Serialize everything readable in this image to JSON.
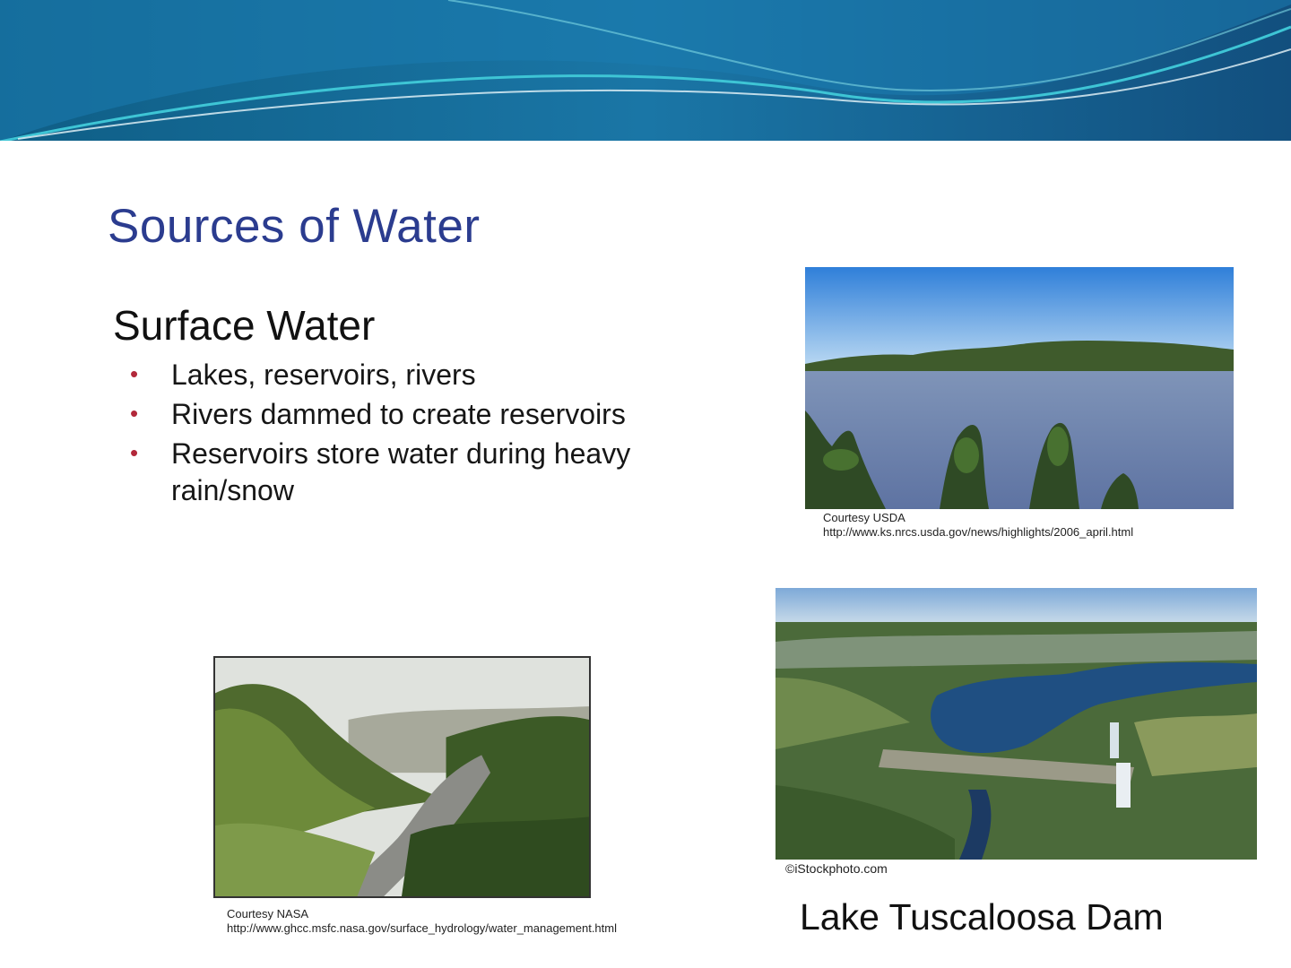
{
  "slide": {
    "title": "Sources of Water",
    "section_heading": "Surface Water",
    "bullets": [
      "Lakes, reservoirs, rivers",
      "Rivers dammed to create reservoirs",
      "Reservoirs store water during heavy rain/snow"
    ]
  },
  "images": {
    "lake": {
      "credit_line1": "Courtesy USDA",
      "credit_line2": "http://www.ks.nrcs.usda.gov/news/highlights/2006_april.html"
    },
    "river": {
      "credit_line1": "Courtesy NASA",
      "credit_line2": "http://www.ghcc.msfc.nasa.gov/surface_hydrology/water_management.html"
    },
    "dam": {
      "credit": "©iStockphoto.com",
      "caption": "Lake Tuscaloosa Dam"
    }
  },
  "colors": {
    "title": "#2b3c8f",
    "bullet": "#b2283a",
    "header_dark": "#135b86",
    "header_light": "#2fb6c9"
  }
}
